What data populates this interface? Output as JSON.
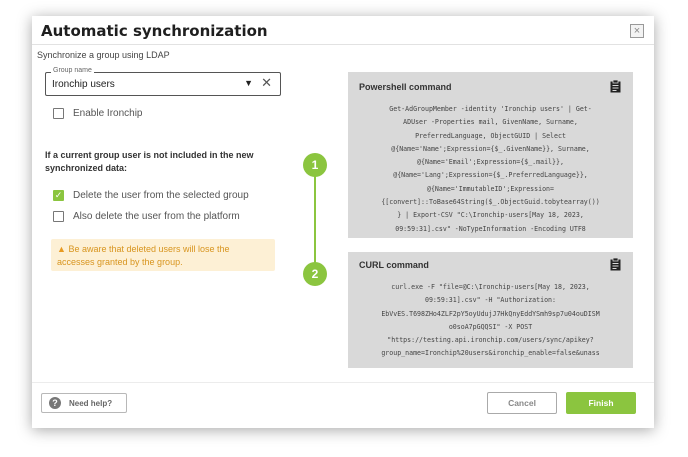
{
  "dialog": {
    "title": "Automatic synchronization",
    "subtitle": "Synchronize a group using LDAP",
    "close_label": "×"
  },
  "group_field": {
    "legend": "Group name",
    "value": "Ironchip users",
    "caret": "▼",
    "clear": "✕"
  },
  "enable_ironchip": {
    "label": "Enable Ironchip",
    "checked": false
  },
  "sync_heading": "If a current group user is not included in the new synchronized data:",
  "options": [
    {
      "label": "Delete the user from the selected group",
      "checked": true
    },
    {
      "label": "Also delete the user from the platform",
      "checked": false
    }
  ],
  "warning": {
    "icon": "warning-triangle-icon",
    "text": "Be aware that deleted users will lose the accesses granted by the group."
  },
  "steps": [
    "1",
    "2"
  ],
  "powershell": {
    "title": "Powershell command",
    "icon": "clipboard-icon",
    "lines": [
      "Get-AdGroupMember -identity 'Ironchip users' | Get-",
      "ADUser -Properties mail, GivenName, Surname,",
      "PreferredLanguage, ObjectGUID | Select",
      "@{Name='Name';Expression={$_.GivenName}}, Surname,",
      "@{Name='Email';Expression={$_.mail}},",
      "@{Name='Lang';Expression={$_.PreferredLanguage}},",
      "@{Name='ImmutableID';Expression=",
      "{[convert]::ToBase64String($_.ObjectGuid.tobytearray())",
      "} | Export-CSV \"C:\\Ironchip-users[May 18, 2023,",
      "09:59:31].csv\" -NoTypeInformation -Encoding UTF8"
    ]
  },
  "curl": {
    "title": "CURL command",
    "icon": "clipboard-icon",
    "lines": [
      "curl.exe -F \"file=@C:\\Ironchip-users[May 18, 2023,",
      "09:59:31].csv\" -H \"Authorization:",
      "EbVvES.T698ZHo4ZLF2pY5oyUdujJ7HkQnyEddYSmh9sp7u04ouDISM",
      "o0soA7pGQQSI\" -X POST",
      "\"https://testing.api.ironchip.com/users/sync/apikey?",
      "group_name=Ironchip%20users&ironchip_enable=false&unass"
    ]
  },
  "footer": {
    "help_label": "Need help?",
    "help_icon_glyph": "?",
    "cancel_label": "Cancel",
    "finish_label": "Finish"
  },
  "colors": {
    "accent": "#8bc53f",
    "warning_bg": "#fdf0d5",
    "warning_text": "#d8951f",
    "code_panel_bg": "#d9d9d9"
  }
}
